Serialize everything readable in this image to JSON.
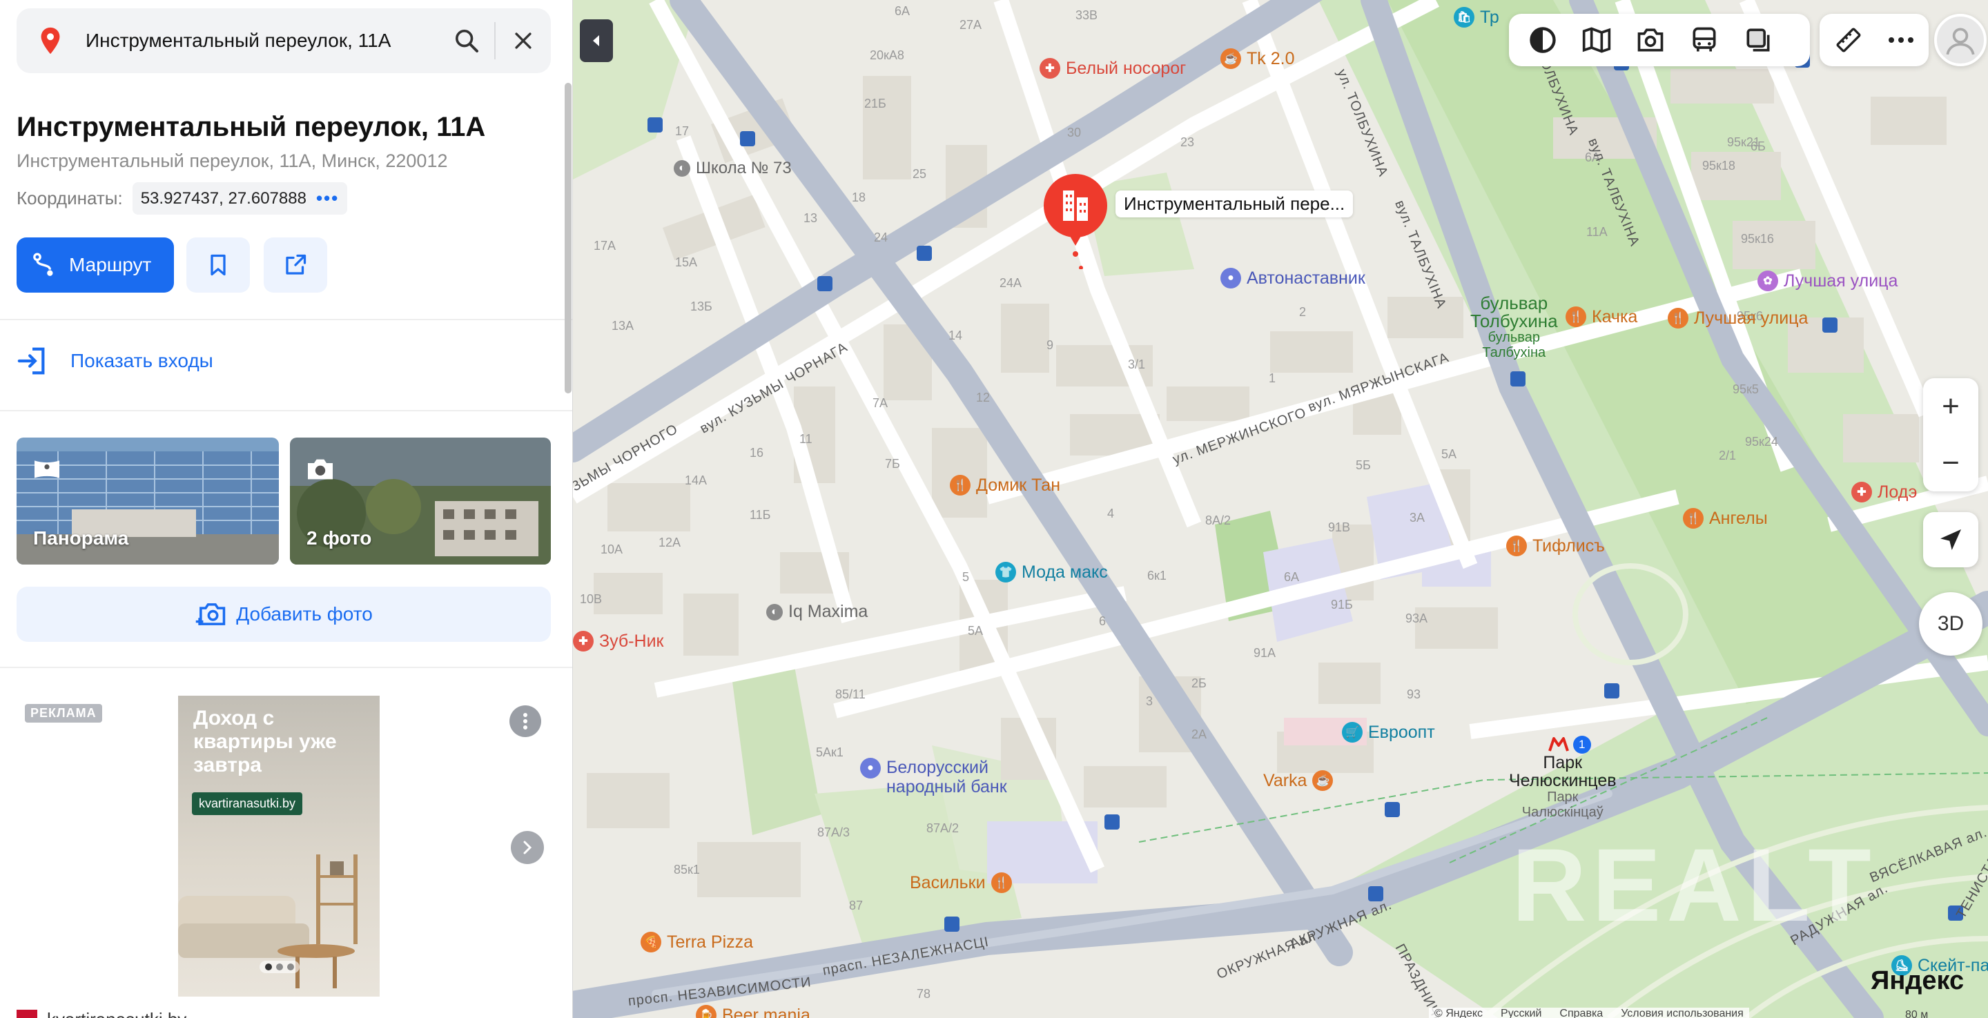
{
  "search": {
    "query": "Инструментальный переулок, 11А"
  },
  "place": {
    "title": "Инструментальный переулок, 11А",
    "address": "Инструментальный переулок, 11А, Минск, 220012",
    "coords_label": "Координаты:",
    "coords_value": "53.927437, 27.607888"
  },
  "actions": {
    "route_label": "Маршрут"
  },
  "entrances_label": "Показать входы",
  "photos": {
    "panorama_label": "Панорама",
    "photos_label": "2 фото"
  },
  "add_photo_label": "Добавить фото",
  "ad": {
    "badge": "РЕКЛАМА",
    "headline": "Доход с квартиры уже завтра",
    "chip": "kvartiranasutki.by",
    "site": "kvartiranasutki.by"
  },
  "map": {
    "marker_label": "Инструментальный пере...",
    "house_numbers": [
      "6А",
      "27А",
      "33В",
      "20кА8",
      "21Б",
      "25",
      "30",
      "23",
      "18",
      "17",
      "13",
      "Школа № 73",
      "24",
      "24А",
      "15А",
      "17А",
      "13Б",
      "13А",
      "9",
      "14",
      "12",
      "3/1",
      "7А",
      "7Б",
      "16",
      "11",
      "14А",
      "11Б",
      "10А",
      "12А",
      "10В",
      "5",
      "8А/2",
      "4",
      "6к1",
      "6А",
      "6",
      "5А",
      "91В",
      "91Б",
      "91А",
      "93А",
      "93",
      "3",
      "2Б",
      "2А",
      "85/11",
      "5Ак1",
      "87А/3",
      "87А/2",
      "85к1",
      "87",
      "78",
      "5Б",
      "5А",
      "3А",
      "2/1",
      "95к24",
      "95к5",
      "95к6",
      "95к16",
      "95к18",
      "95к21",
      "6Б",
      "11А",
      "2",
      "1",
      "4"
    ],
    "pois": [
      {
        "name": "Белый носорог",
        "color": "#e5594c"
      },
      {
        "name": "Tk 2.0",
        "color": "#e87a2e"
      },
      {
        "name": "Автонаставник",
        "color": "#6b7bdc"
      },
      {
        "name": "Лучшая улица",
        "color": "#b46fd6"
      },
      {
        "name": "Качка",
        "color": "#e87a2e"
      },
      {
        "name": "Лучшая улица",
        "color": "#e87a2e"
      },
      {
        "name": "Домик Тан",
        "color": "#e87a2e"
      },
      {
        "name": "Мода макс",
        "color": "#1aa3c8"
      },
      {
        "name": "Iq Maxima",
        "color": "#8a8a8a"
      },
      {
        "name": "Зуб-Ник",
        "color": "#e5594c"
      },
      {
        "name": "Белорусский народный банк",
        "color": "#6b7bdc"
      },
      {
        "name": "Евроопт",
        "color": "#1aa3c8"
      },
      {
        "name": "Varka",
        "color": "#e87a2e"
      },
      {
        "name": "Васильки",
        "color": "#e87a2e"
      },
      {
        "name": "Terra Pizza",
        "color": "#e87a2e"
      },
      {
        "name": "Тифлисъ",
        "color": "#e87a2e"
      },
      {
        "name": "Ангелы",
        "color": "#e87a2e"
      },
      {
        "name": "Лодэ",
        "color": "#e5594c"
      },
      {
        "name": "Beer mania",
        "color": "#e87a2e"
      },
      {
        "name": "Тр",
        "color": "#1aa3c8"
      },
      {
        "name": "Скейт-па",
        "color": "#1aa3c8"
      }
    ],
    "streets": [
      "вул. КУЗЬМЫ ЧОРНАГА",
      "ЗЬМЫ ЧОРНОГО",
      "ул. МЕРЖИНСКОГО",
      "вул. МЯРЖЫНСКАГА",
      "ул. ТОЛБУХИНА",
      "вул. ТАЛБУХІНА",
      "ул. ТОЛБУХИНА",
      "вул. ТАЛБУХІНА",
      "просп. НЕЗАВИСИМОСТИ",
      "прасп. НЕЗАЛЕЖНАСЦІ",
      "ОКРУЖНАЯ ал.",
      "АКРУЖНАЯ ал.",
      "РАДУЖНАЯ ал.",
      "ВЯСЁЛКАВАЯ ал.",
      "ПРАЗДНИЧНАЯ",
      "ТЕНИСТАЯ"
    ],
    "boulevard": [
      "бульвар",
      "Толбухина",
      "бульвар",
      "Талбухіна"
    ],
    "metro": [
      "Парк",
      "Челюскинцев",
      "Парк",
      "Чалюскінцаў"
    ],
    "metro_line": "1",
    "watermark": "REALT",
    "logo": "Яндекс",
    "copyright": [
      "© Яндекс",
      "Русский",
      "Справка",
      "Условия использования"
    ],
    "scale": "80 м",
    "btn_3d": "3D",
    "zoom_in": "+",
    "zoom_out": "−"
  }
}
